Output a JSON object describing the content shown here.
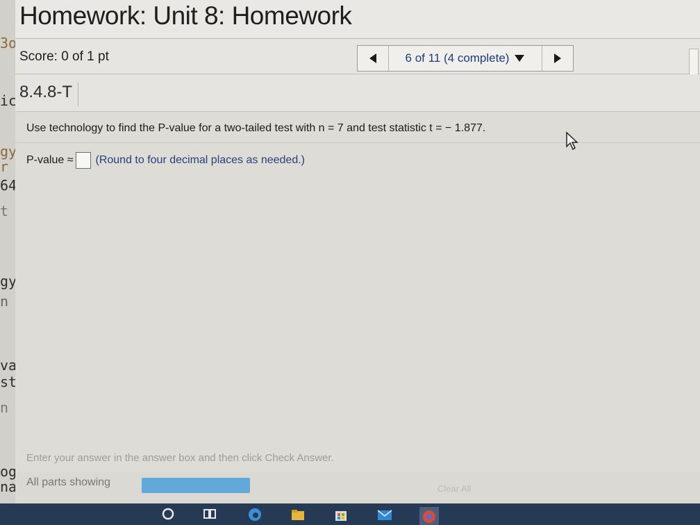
{
  "left_strip": [
    "3o",
    "ic",
    "gy",
    "r",
    "64",
    "t =",
    "gy",
    "n t",
    "val",
    "sti",
    "n th",
    "ogy",
    "nal"
  ],
  "header": {
    "title": "Homework: Unit 8: Homework"
  },
  "score": {
    "text": "Score: 0 of 1 pt"
  },
  "nav": {
    "position_label": "6 of 11 (4 complete)"
  },
  "question": {
    "id": "8.4.8-T",
    "prompt": "Use technology to find the P-value for a two-tailed test with n = 7 and test statistic t = − 1.877.",
    "answer_label": "P-value ≈",
    "answer_value": "",
    "hint": "(Round to four decimal places as needed.)"
  },
  "footer": {
    "instructions": "Enter your answer in the answer box and then click Check Answer.",
    "parts_label": "All parts showing",
    "clear_all": "Clear All"
  },
  "colors": {
    "accent": "#62a8d8",
    "taskbar": "#263a55",
    "hint_text": "#25407a"
  },
  "taskbar": {
    "icons": [
      "search-circle-icon",
      "task-view-icon",
      "edge-icon",
      "file-explorer-icon",
      "store-icon",
      "mail-icon",
      "chrome-icon"
    ]
  }
}
